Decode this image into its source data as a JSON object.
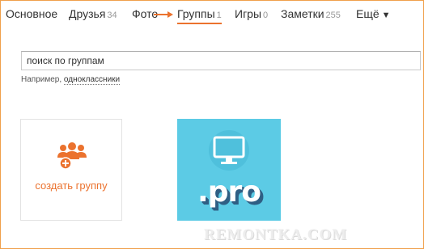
{
  "nav": {
    "items": [
      {
        "label": "Основное",
        "count": ""
      },
      {
        "label": "Друзья",
        "count": "34"
      },
      {
        "label": "Фото",
        "count": ""
      },
      {
        "label": "Группы",
        "count": "1"
      },
      {
        "label": "Игры",
        "count": "0"
      },
      {
        "label": "Заметки",
        "count": "255"
      },
      {
        "label": "Ещё",
        "count": ""
      }
    ],
    "more_caret": "▼",
    "active_color": "#eb722e"
  },
  "search": {
    "value": "поиск по группам",
    "placeholder": "поиск по группам",
    "hint_prefix": "Например, ",
    "hint_link": "одноклассники"
  },
  "cards": {
    "create_label": "создать группу",
    "create_icon": "add-group-icon",
    "group_logo_text": ".pro",
    "group_bg_color": "#5ccbe5"
  },
  "watermark": "REMONTKA.COM"
}
